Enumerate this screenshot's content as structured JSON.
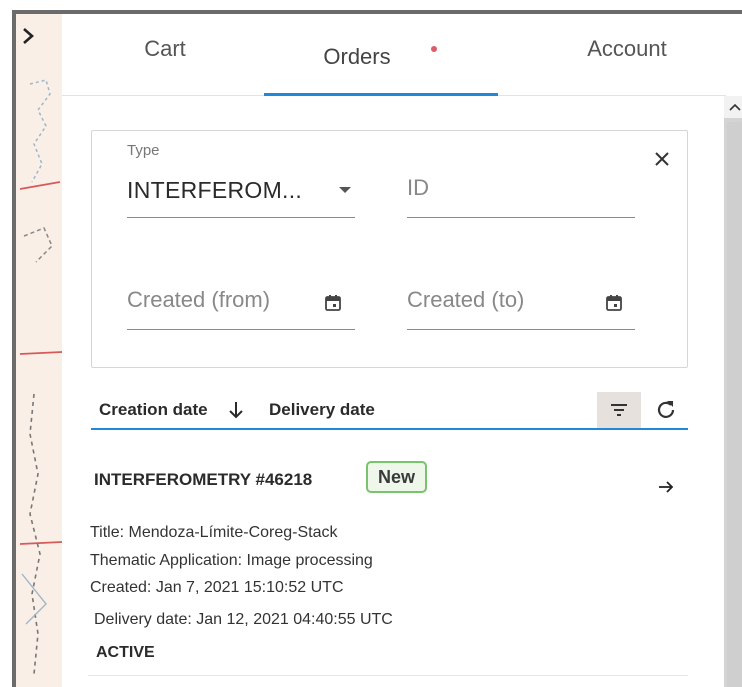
{
  "tabs": {
    "cart": "Cart",
    "orders": "Orders",
    "account": "Account",
    "active": "Orders"
  },
  "filters": {
    "type_label": "Type",
    "type_value": "INTERFEROM...",
    "id_placeholder": "ID",
    "created_from_placeholder": "Created (from)",
    "created_to_placeholder": "Created (to)"
  },
  "sort": {
    "creation_date": "Creation date",
    "delivery_date": "Delivery date",
    "direction": "descending"
  },
  "orders": [
    {
      "title": "INTERFEROMETRY #46218",
      "badge": "New",
      "detail_title": "Title: Mendoza-Límite-Coreg-Stack",
      "detail_app": "Thematic Application: Image processing",
      "detail_created": "Created:  Jan 7, 2021 15:10:52 UTC",
      "detail_delivery": "Delivery date:  Jan 12, 2021 04:40:55 UTC",
      "status": "ACTIVE"
    }
  ],
  "colors": {
    "accent": "#1f88d9",
    "badge_border": "#78c46c",
    "notification_dot": "#e05a68",
    "map_background": "#f9efe7"
  },
  "icons": [
    "chevron-right-icon",
    "close-icon",
    "calendar-icon",
    "arrow-down-icon",
    "filter-icon",
    "refresh-icon",
    "arrow-right-icon",
    "caret-down-icon",
    "chevron-up-icon"
  ]
}
